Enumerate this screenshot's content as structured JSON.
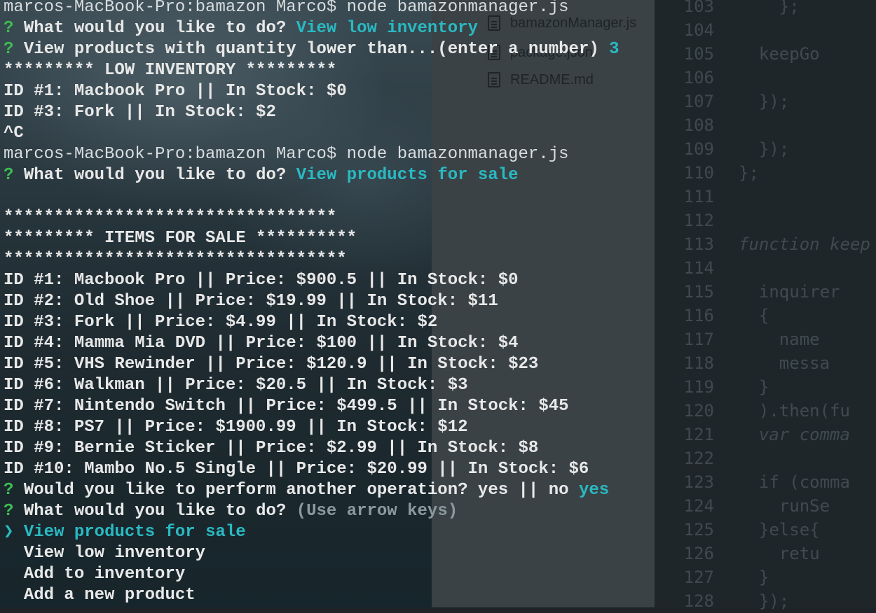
{
  "terminal": {
    "lines": [
      {
        "type": "cmd",
        "text": "marcos-MacBook-Pro:bamazon Marco$ node bamazonmanager.js"
      },
      {
        "type": "q",
        "prefix": "?",
        "text": "What would you like to do?",
        "answer": "View low inventory"
      },
      {
        "type": "q",
        "prefix": "?",
        "text": "View products with quantity lower than...(enter a number)",
        "answer": "3"
      },
      {
        "type": "out",
        "text": "********* LOW INVENTORY *********"
      },
      {
        "type": "out",
        "text": "ID #1: Macbook Pro || In Stock: $0"
      },
      {
        "type": "out",
        "text": "ID #3: Fork || In Stock: $2"
      },
      {
        "type": "out",
        "text": "^C"
      },
      {
        "type": "cmd",
        "text": "marcos-MacBook-Pro:bamazon Marco$ node bamazonmanager.js"
      },
      {
        "type": "q",
        "prefix": "?",
        "text": "What would you like to do?",
        "answer": "View products for sale"
      },
      {
        "type": "out",
        "text": ""
      },
      {
        "type": "out",
        "text": "*********************************"
      },
      {
        "type": "out",
        "text": "********* ITEMS FOR SALE **********"
      },
      {
        "type": "out",
        "text": "**********************************"
      },
      {
        "type": "out",
        "text": "ID #1: Macbook Pro || Price: $900.5 || In Stock: $0"
      },
      {
        "type": "out",
        "text": "ID #2: Old Shoe || Price: $19.99 || In Stock: $11"
      },
      {
        "type": "out",
        "text": "ID #3: Fork || Price: $4.99 || In Stock: $2"
      },
      {
        "type": "out",
        "text": "ID #4: Mamma Mia DVD || Price: $100 || In Stock: $4"
      },
      {
        "type": "out",
        "text": "ID #5: VHS Rewinder || Price: $120.9 || In Stock: $23"
      },
      {
        "type": "out",
        "text": "ID #6: Walkman || Price: $20.5 || In Stock: $3"
      },
      {
        "type": "out",
        "text": "ID #7: Nintendo Switch || Price: $499.5 || In Stock: $45"
      },
      {
        "type": "out",
        "text": "ID #8: PS7 || Price: $1900.99 || In Stock: $12"
      },
      {
        "type": "out",
        "text": "ID #9: Bernie Sticker || Price: $2.99 || In Stock: $8"
      },
      {
        "type": "out",
        "text": "ID #10: Mambo No.5 Single || Price: $20.99 || In Stock: $6"
      },
      {
        "type": "q",
        "prefix": "?",
        "text": "Would you like to perform another operation? yes || no",
        "answer": "yes"
      },
      {
        "type": "hint",
        "prefix": "?",
        "text": "What would you like to do?",
        "answer": "(Use arrow keys)"
      },
      {
        "type": "choice-selected",
        "prefix": "❯",
        "text": "View products for sale"
      },
      {
        "type": "choice",
        "text": "View low inventory"
      },
      {
        "type": "choice",
        "text": "Add to inventory"
      },
      {
        "type": "choice",
        "text": "Add a new product"
      }
    ]
  },
  "file_panel": {
    "files": [
      {
        "name": "bamazonManager.js",
        "icon": "file-icon"
      },
      {
        "name": "package.json",
        "icon": "file-icon"
      },
      {
        "name": "README.md",
        "icon": "file-icon"
      }
    ]
  },
  "code_editor": {
    "line_numbers": [
      "103",
      "104",
      "105",
      "106",
      "107",
      "108",
      "109",
      "110",
      "111",
      "112",
      "113",
      "114",
      "115",
      "116",
      "117",
      "118",
      "119",
      "120",
      "121",
      "122",
      "123",
      "124",
      "125",
      "126",
      "127",
      "128"
    ],
    "code_lines": [
      "    };",
      "",
      "  keepGo",
      "",
      "  });",
      "",
      "  });",
      "};",
      "",
      "",
      "function keep",
      "",
      "  inquirer",
      "  {",
      "    name",
      "    messa",
      "  }",
      "  ).then(fu",
      "  var comma",
      "",
      "  if (comma",
      "    runSe",
      "  }else{",
      "    retu",
      "  }",
      "  });"
    ]
  },
  "colors": {
    "prompt_prefix": "#3dbd53",
    "answer": "#2ab9c1",
    "hint": "#8b9a9e",
    "text": "#e8e8e8"
  }
}
